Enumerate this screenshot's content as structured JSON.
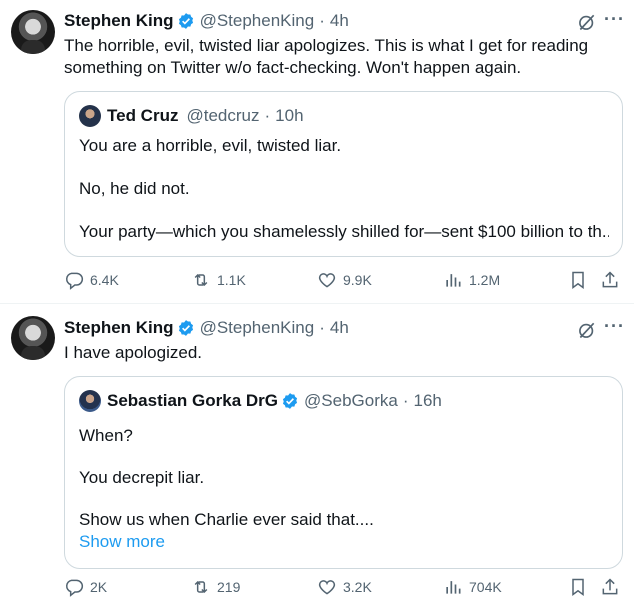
{
  "tweets": [
    {
      "author_name": "Stephen King",
      "handle": "@StephenKing",
      "dot": "·",
      "time": "4h",
      "text_lines": [
        "The horrible, evil, twisted liar apologizes. This is what I get for reading",
        "something on Twitter w/o fact-checking. Won't happen again."
      ],
      "quote": {
        "author_name": "Ted Cruz",
        "handle": "@tedcruz",
        "dot": "·",
        "time": "10h",
        "lines": [
          "You are a horrible, evil, twisted liar.",
          "No, he did not.",
          "Your party—which you shamelessly shilled for—sent $100 billion to th..."
        ]
      },
      "metrics": {
        "replies": "6.4K",
        "reposts": "1.1K",
        "likes": "9.9K",
        "views": "1.2M"
      }
    },
    {
      "author_name": "Stephen King",
      "handle": "@StephenKing",
      "dot": "·",
      "time": "4h",
      "text_lines": [
        "I have apologized."
      ],
      "quote": {
        "author_name": "Sebastian Gorka DrG",
        "handle": "@SebGorka",
        "dot": "·",
        "time": "16h",
        "lines": [
          "When?",
          "You decrepit liar.",
          "Show us when Charlie ever said that...."
        ],
        "show_more": "Show more"
      },
      "metrics": {
        "replies": "2K",
        "reposts": "219",
        "likes": "3.2K",
        "views": "704K"
      }
    }
  ],
  "icons": {
    "verified": "verified-badge-icon",
    "grok": "grok-icon",
    "more": "more-icon",
    "reply": "reply-icon",
    "repost": "repost-icon",
    "like": "like-icon",
    "views": "views-icon",
    "bookmark": "bookmark-icon",
    "share": "share-icon"
  },
  "colors": {
    "accent": "#1d9bf0",
    "secondary_text": "#536471",
    "border": "#cfd9de"
  }
}
